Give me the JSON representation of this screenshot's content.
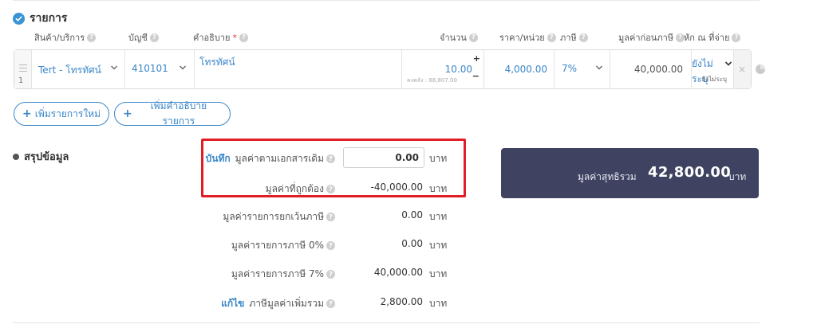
{
  "items_section": {
    "title": "รายการ",
    "columns": {
      "product": "สินค้า/บริการ",
      "account": "บัญชี",
      "description": "คำอธิบาย",
      "required_mark": "*",
      "quantity": "จำนวน",
      "unit_price": "ราคา/หน่วย",
      "tax": "ภาษี",
      "pre_tax_amount": "มูลค่าก่อนภาษี",
      "withholding": "หัก ณ ที่จ่าย"
    },
    "row": {
      "number": "1",
      "product": "Tert - โทรทัศน์",
      "account": "410101",
      "description": "โทรทัศน์",
      "quantity": "10.00",
      "stock_note": "คงคลัง : 88,807.00",
      "unit_price": "4,000.00",
      "tax": "7%",
      "pre_tax_amount": "40,000.00",
      "withholding": "ยังไม่ระบุ",
      "withholding_sub": "ยังไม่ระบุ",
      "plus": "+",
      "minus": "−",
      "delete": "×"
    },
    "add_item_label": "เพิ่มรายการใหม่",
    "add_desc_label": "เพิ่มคำอธิบายรายการ",
    "plus_sign": "+"
  },
  "summary": {
    "title": "สรุปข้อมูล",
    "save_link": "บันทึก",
    "original_value_label": "มูลค่าตามเอกสารเดิม",
    "original_value": "0.00",
    "correct_value_label": "มูลค่าที่ถูกต้อง",
    "correct_value": "-40,000.00",
    "exempt_label": "มูลค่ารายการยกเว้นภาษี",
    "exempt_value": "0.00",
    "zero_tax_label": "มูลค่ารายการภาษี 0%",
    "zero_tax_value": "0.00",
    "tax7_label": "มูลค่ารายการภาษี 7%",
    "tax7_value": "40,000.00",
    "edit_link": "แก้ไข",
    "vat_label": "ภาษีมูลค่าเพิ่มรวม",
    "vat_value": "2,800.00",
    "unit": "บาท",
    "net_total_label": "มูลค่าสุทธิรวม",
    "net_total_value": "42,800.00"
  },
  "colors": {
    "accent": "#3a86c8",
    "highlight": "#e11e26",
    "total_bg": "#3f4361"
  }
}
